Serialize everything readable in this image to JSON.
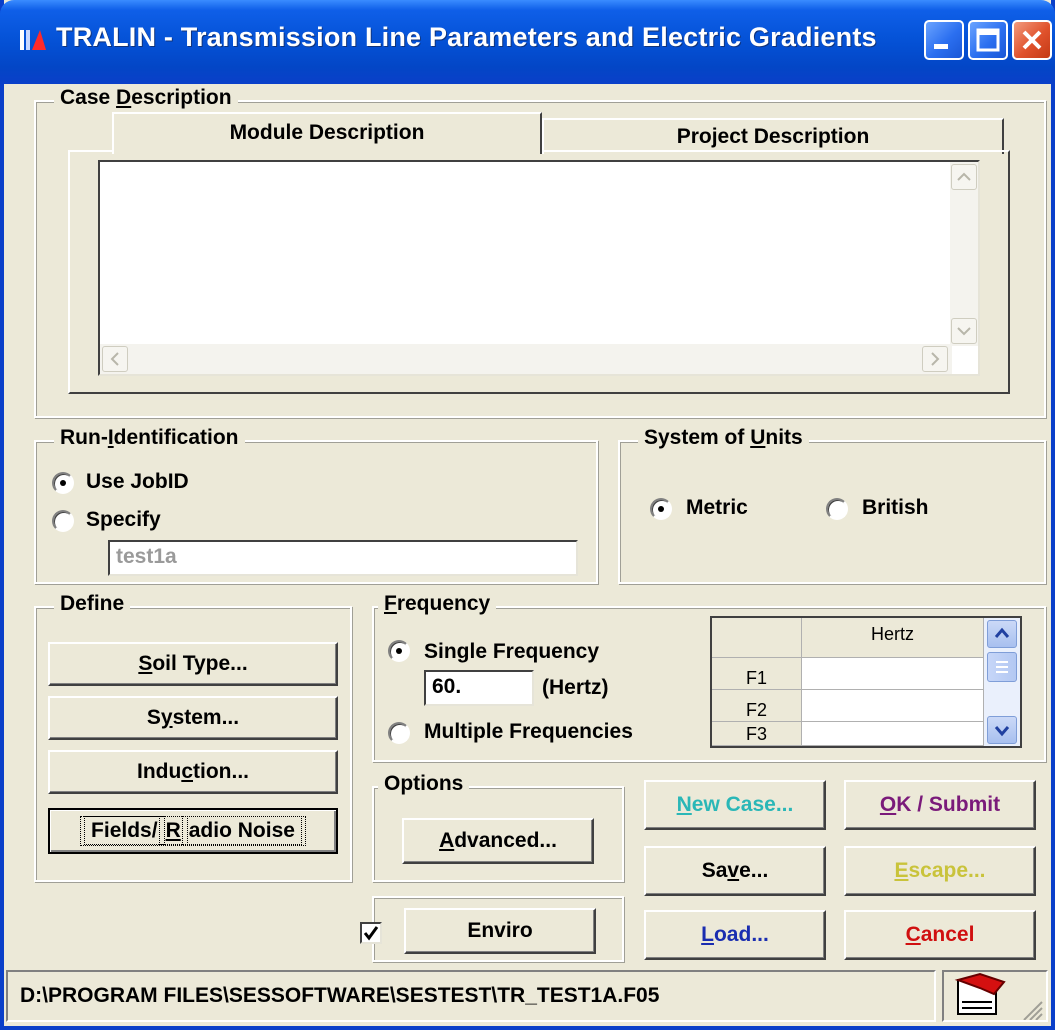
{
  "window": {
    "title": "TRALIN - Transmission Line Parameters and Electric Gradients",
    "colors": {
      "titlebar": "#0553d8",
      "face": "#ece9d8",
      "close": "#e0522c"
    }
  },
  "case_description": {
    "label_pre": "Case ",
    "label_accel": "D",
    "label_post": "escription",
    "tabs": [
      {
        "label": "Module Description",
        "selected": true
      },
      {
        "label": "Project Description",
        "selected": false
      }
    ],
    "text": ""
  },
  "run_identification": {
    "label_pre": "Run-",
    "label_accel": "I",
    "label_post": "dentification",
    "options": [
      {
        "label": "Use JobID",
        "checked": true
      },
      {
        "label": "Specify",
        "checked": false
      }
    ],
    "specify_value": "test1a"
  },
  "system_of_units": {
    "label_pre": "System of ",
    "label_accel": "U",
    "label_post": "nits",
    "options": [
      {
        "label": "Metric",
        "checked": true
      },
      {
        "label": "British",
        "checked": false
      }
    ]
  },
  "define": {
    "label": "Define",
    "buttons": [
      {
        "pre": "",
        "accel": "S",
        "post": "oil Type..."
      },
      {
        "pre": "S",
        "accel": "y",
        "post": "stem..."
      },
      {
        "pre": "Indu",
        "accel": "c",
        "post": "tion..."
      },
      {
        "pre": "Fields/",
        "accel": "R",
        "post": "adio Noise"
      }
    ]
  },
  "frequency": {
    "label_pre": "",
    "label_accel": "F",
    "label_post": "requency",
    "single_label": "Single Frequency",
    "single_checked": true,
    "value": "60.",
    "unit": "(Hertz)",
    "multiple_label": "Multiple Frequencies",
    "multiple_checked": false,
    "grid_header": "Hertz",
    "rows": [
      "F1",
      "F2",
      "F3"
    ]
  },
  "options": {
    "label": "Options",
    "advanced": {
      "pre": "",
      "accel": "A",
      "post": "dvanced..."
    },
    "enviro_label": "Enviro",
    "enviro_checked": true
  },
  "actions": {
    "new_case": {
      "pre": "",
      "accel": "N",
      "post": "ew Case...",
      "color": "#2ab7b7"
    },
    "ok_submit": {
      "pre": "",
      "accel": "O",
      "post": "K / Submit",
      "color": "#7a1a7a"
    },
    "save": {
      "pre": "Sa",
      "accel": "v",
      "post": "e...",
      "color": "#000000"
    },
    "escape": {
      "pre": "",
      "accel": "E",
      "post": "scape...",
      "color": "#c9c33a"
    },
    "load": {
      "pre": "",
      "accel": "L",
      "post": "oad...",
      "color": "#1a2db0"
    },
    "cancel": {
      "pre": "",
      "accel": "C",
      "post": "ancel",
      "color": "#d01010"
    }
  },
  "status": {
    "path": "D:\\PROGRAM FILES\\SESSOFTWARE\\SESTEST\\TR_TEST1A.F05",
    "icon": "red-flag-icon"
  }
}
